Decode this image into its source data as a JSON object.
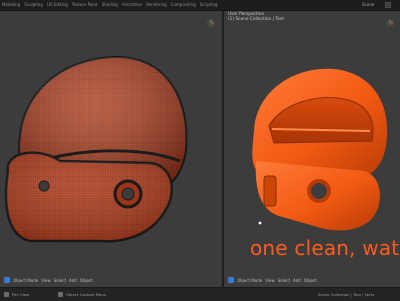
{
  "topbar": {
    "tabs": [
      "Modeling",
      "Sculpting",
      "UV Editing",
      "Texture Paint",
      "Shading",
      "Animation",
      "Rendering",
      "Compositing",
      "Scripting"
    ],
    "scene": "Scene"
  },
  "viewport_right": {
    "title": "User Perspective",
    "subtitle": "(1) Scene Collection | Text"
  },
  "overlay_text": "one clean, watertigh",
  "viewport_left_footer": {
    "mode": "Object Mode",
    "menus": [
      "View",
      "Select",
      "Add",
      "Object"
    ]
  },
  "viewport_right_footer": {
    "mode": "Object Mode",
    "menus": [
      "View",
      "Select",
      "Add",
      "Object"
    ]
  },
  "statusbar": {
    "left": "Pan View",
    "mid": "Object Context Menu",
    "right": "Scene Collection | Text | Verts"
  },
  "colors": {
    "helmet_left": "#b94322",
    "helmet_right": "#f25a12",
    "accent_blue": "#3d7bd1"
  }
}
